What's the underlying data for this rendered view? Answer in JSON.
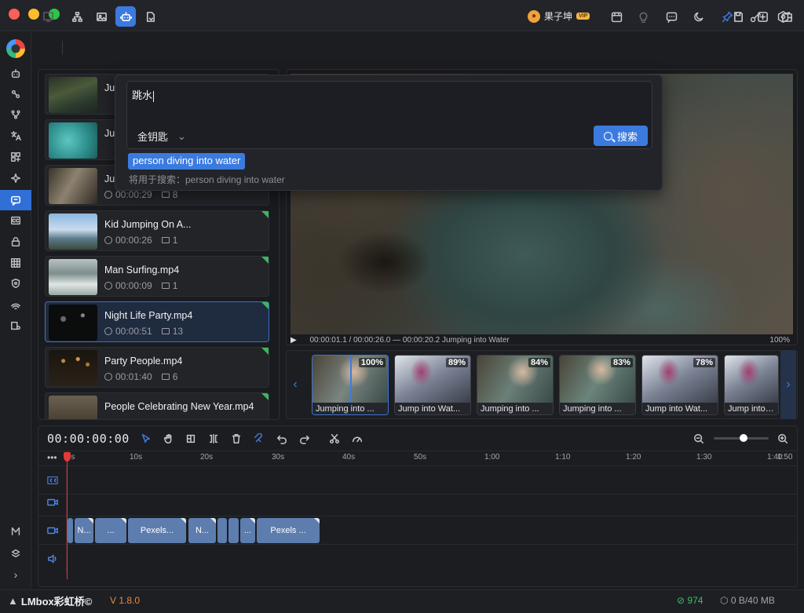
{
  "window": {
    "traffic_lights": [
      "#ff5f57",
      "#febc2e",
      "#28c840"
    ]
  },
  "header": {
    "user_name": "果子坤",
    "vip_badge": "VIP",
    "icons": [
      "calendar-icon",
      "bulb-icon",
      "message-icon",
      "moon-icon",
      "pin-icon",
      "key-icon",
      "settings-icon"
    ]
  },
  "sidebar": {
    "icons": [
      "robot-icon",
      "nodes-icon",
      "flow-icon",
      "translate-icon",
      "grid-icon",
      "sparkle-icon",
      "chat-search-icon",
      "cc-icon",
      "lock-icon",
      "table-icon",
      "shield-icon",
      "signal-icon",
      "settings-gear-icon"
    ],
    "active_index": 6,
    "bottom_icons": [
      "m-icon",
      "layers-icon",
      "chevron-right-icon"
    ]
  },
  "toolbar": {
    "left_icons": [
      "export-icon",
      "hierarchy-icon",
      "image-icon",
      "robot-search-icon",
      "file-sync-icon"
    ],
    "right_icons": [
      "save-icon",
      "add-icon",
      "wallet-icon"
    ]
  },
  "clips": [
    {
      "name": "Ju",
      "duration": "",
      "count": "",
      "tag": false
    },
    {
      "name": "Ju",
      "duration": "",
      "count": "",
      "tag": false
    },
    {
      "name": "Ju",
      "duration": "00:00:29",
      "count": "8",
      "tag": false
    },
    {
      "name": "Kid Jumping On A...",
      "duration": "00:00:26",
      "count": "1",
      "tag": true
    },
    {
      "name": "Man Surfing.mp4",
      "duration": "00:00:09",
      "count": "1",
      "tag": true
    },
    {
      "name": "Night Life Party.mp4",
      "duration": "00:00:51",
      "count": "13",
      "tag": true
    },
    {
      "name": "Party People.mp4",
      "duration": "00:01:40",
      "count": "6",
      "tag": true
    },
    {
      "name": "People Celebrating New Year.mp4",
      "duration": "",
      "count": "",
      "tag": true
    }
  ],
  "search": {
    "query": "跳水",
    "model": "金钥匙",
    "button": "搜索",
    "suggestion": "person diving into water",
    "hint": "将用于搜索：person diving into water"
  },
  "player": {
    "status": "00:00:01.1 / 00:00:26.0 — 00:00:20.2 Jumping into Water",
    "zoom": "100%"
  },
  "results": [
    {
      "label": "Jumping into ...",
      "score": "100%",
      "selected": true
    },
    {
      "label": "Jump into Wat...",
      "score": "89%",
      "selected": false
    },
    {
      "label": "Jumping into ...",
      "score": "84%",
      "selected": false
    },
    {
      "label": "Jumping into ...",
      "score": "83%",
      "selected": false
    },
    {
      "label": "Jump into Wat...",
      "score": "78%",
      "selected": false
    },
    {
      "label": "Jump into W",
      "score": "",
      "selected": false
    }
  ],
  "timeline": {
    "timecode": "00:00:00:00",
    "ruler": [
      "0s",
      "10s",
      "20s",
      "30s",
      "40s",
      "50s",
      "1:00",
      "1:10",
      "1:20",
      "1:30",
      "1:40",
      "1:50"
    ],
    "segments": [
      "",
      "N...",
      "...",
      "Pexels...",
      "N...",
      "",
      "",
      "...",
      "Pexels ..."
    ]
  },
  "status": {
    "brand": "LMbox彩虹桥©",
    "version": "V 1.8.0",
    "count": "974",
    "memory": "0 B/40 MB"
  }
}
